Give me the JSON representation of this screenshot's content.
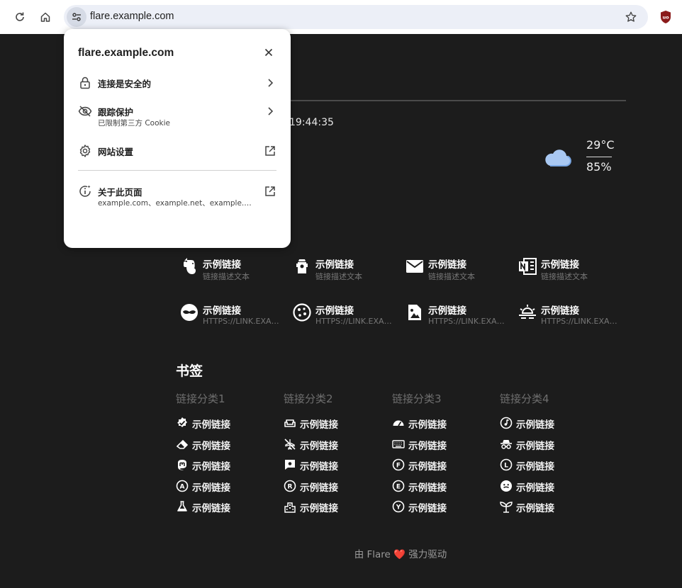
{
  "browser": {
    "url": "flare.example.com"
  },
  "page": {
    "clock": "19:44:35",
    "weather": {
      "temperature": "29°C",
      "humidity": "85%",
      "icon": "cloud-icon"
    },
    "apps": [
      {
        "title": "示例链接",
        "desc": "链接描述文本",
        "icon": "evernote-icon"
      },
      {
        "title": "示例链接",
        "desc": "链接描述文本",
        "icon": "fire-hydrant-icon"
      },
      {
        "title": "示例链接",
        "desc": "链接描述文本",
        "icon": "email-icon"
      },
      {
        "title": "示例链接",
        "desc": "链接描述文本",
        "icon": "onenote-icon"
      },
      {
        "title": "示例链接",
        "desc": "HTTPS://LINK.EXAMPLE.COM",
        "icon": "mask-icon"
      },
      {
        "title": "示例链接",
        "desc": "HTTPS://LINK.EXAMPLE.COM",
        "icon": "cookie-icon"
      },
      {
        "title": "示例链接",
        "desc": "HTTPS://LINK.EXAMPLE.COM",
        "icon": "image-file-icon"
      },
      {
        "title": "示例链接",
        "desc": "HTTPS://LINK.EXAMPLE.COM",
        "icon": "sunset-icon"
      }
    ],
    "bookmarks_title": "书签",
    "bookmark_columns": [
      {
        "category": "链接分类1",
        "items": [
          {
            "label": "示例链接",
            "icon": "verified-badge-icon"
          },
          {
            "label": "示例链接",
            "icon": "eraser-icon"
          },
          {
            "label": "示例链接",
            "icon": "mastodon-icon"
          },
          {
            "label": "示例链接",
            "icon": "letter-a-circle-icon"
          },
          {
            "label": "示例链接",
            "icon": "flask-icon"
          }
        ]
      },
      {
        "category": "链接分类2",
        "items": [
          {
            "label": "示例链接",
            "icon": "sofa-icon"
          },
          {
            "label": "示例链接",
            "icon": "airplane-off-icon"
          },
          {
            "label": "示例链接",
            "icon": "message-gear-icon"
          },
          {
            "label": "示例链接",
            "icon": "registered-icon"
          },
          {
            "label": "示例链接",
            "icon": "city-icon"
          }
        ]
      },
      {
        "category": "链接分类3",
        "items": [
          {
            "label": "示例链接",
            "icon": "gauge-icon"
          },
          {
            "label": "示例链接",
            "icon": "keyboard-icon"
          },
          {
            "label": "示例链接",
            "icon": "letter-f-circle-icon"
          },
          {
            "label": "示例链接",
            "icon": "letter-e-circle-icon"
          },
          {
            "label": "示例链接",
            "icon": "letter-y-circle-icon"
          }
        ]
      },
      {
        "category": "链接分类4",
        "items": [
          {
            "label": "示例链接",
            "icon": "music-note-icon"
          },
          {
            "label": "示例链接",
            "icon": "incognito-icon"
          },
          {
            "label": "示例链接",
            "icon": "letter-l-circle-icon"
          },
          {
            "label": "示例链接",
            "icon": "emoticon-icon"
          },
          {
            "label": "示例链接",
            "icon": "sprout-icon"
          }
        ]
      }
    ],
    "footer": {
      "prefix": "由 Flare",
      "heart": "❤️",
      "suffix": "强力驱动"
    }
  },
  "popup": {
    "title": "flare.example.com",
    "rows": [
      {
        "label": "连接是安全的",
        "icon": "lock-icon",
        "action": "chevron-right-icon"
      },
      {
        "label": "跟踪保护",
        "sub": "已限制第三方 Cookie",
        "icon": "eye-off-icon",
        "action": "chevron-right-icon"
      },
      {
        "label": "网站设置",
        "icon": "gear-icon",
        "action": "open-external-icon"
      },
      {
        "label": "关于此页面",
        "sub": "example.com、example.net、example.org",
        "icon": "info-icon",
        "action": "open-external-icon"
      }
    ]
  }
}
